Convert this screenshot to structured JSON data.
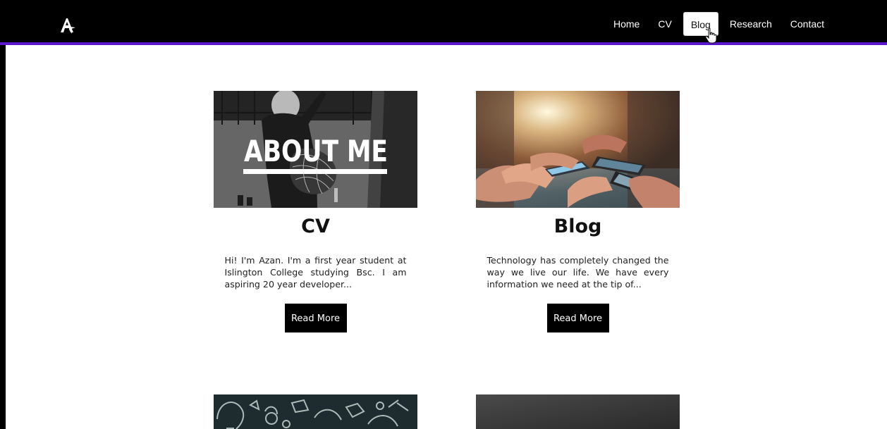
{
  "nav": {
    "items": [
      {
        "label": "Home",
        "active": false
      },
      {
        "label": "CV",
        "active": false
      },
      {
        "label": "Blog",
        "active": true
      },
      {
        "label": "Research",
        "active": false
      },
      {
        "label": "Contact",
        "active": false
      }
    ]
  },
  "colors": {
    "topbar": "#000000",
    "accent": "#5a17c9",
    "button": "#000000"
  },
  "cards": [
    {
      "title": "CV",
      "image_caption": "ABOUT ME",
      "text": "Hi! I'm Azan. I'm a first year student at Islington College studying Bsc. I am aspiring 20 year developer...",
      "button": "Read More"
    },
    {
      "title": "Blog",
      "text": "Technology has completely changed the way we live our life. We have every information we need at the tip of...",
      "button": "Read More"
    }
  ],
  "icons": {
    "logo": "logo-icon",
    "cursor": "hand-cursor-icon"
  }
}
